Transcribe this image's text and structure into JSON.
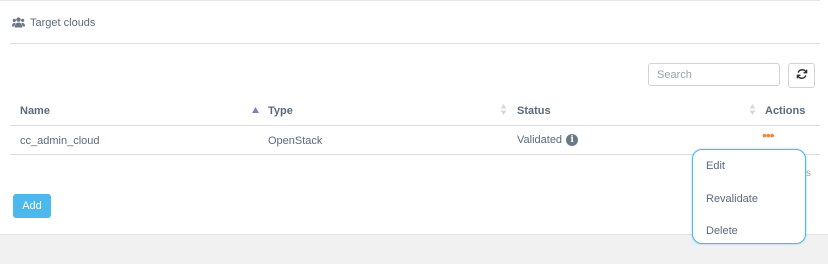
{
  "panel": {
    "title": "Target clouds",
    "title_icon": "users-icon"
  },
  "toolbar": {
    "search_placeholder": "Search",
    "refresh_icon": "refresh-icon"
  },
  "table": {
    "columns": [
      "Name",
      "Type",
      "Status",
      "Actions"
    ],
    "sorted_column": "Name",
    "sort_direction": "ascending",
    "rows": [
      {
        "name": "cc_admin_cloud",
        "type": "OpenStack",
        "status": "Validated",
        "status_icon": "info-icon",
        "actions_icon": "more-icon"
      }
    ]
  },
  "pagination_fragment": "s",
  "add_button_label": "Add",
  "actions_menu": {
    "items": [
      "Edit",
      "Revalidate",
      "Delete"
    ]
  },
  "colors": {
    "accent": "#4db8ec",
    "actions_icon": "#f0883e",
    "text": "#5b6a7f"
  }
}
